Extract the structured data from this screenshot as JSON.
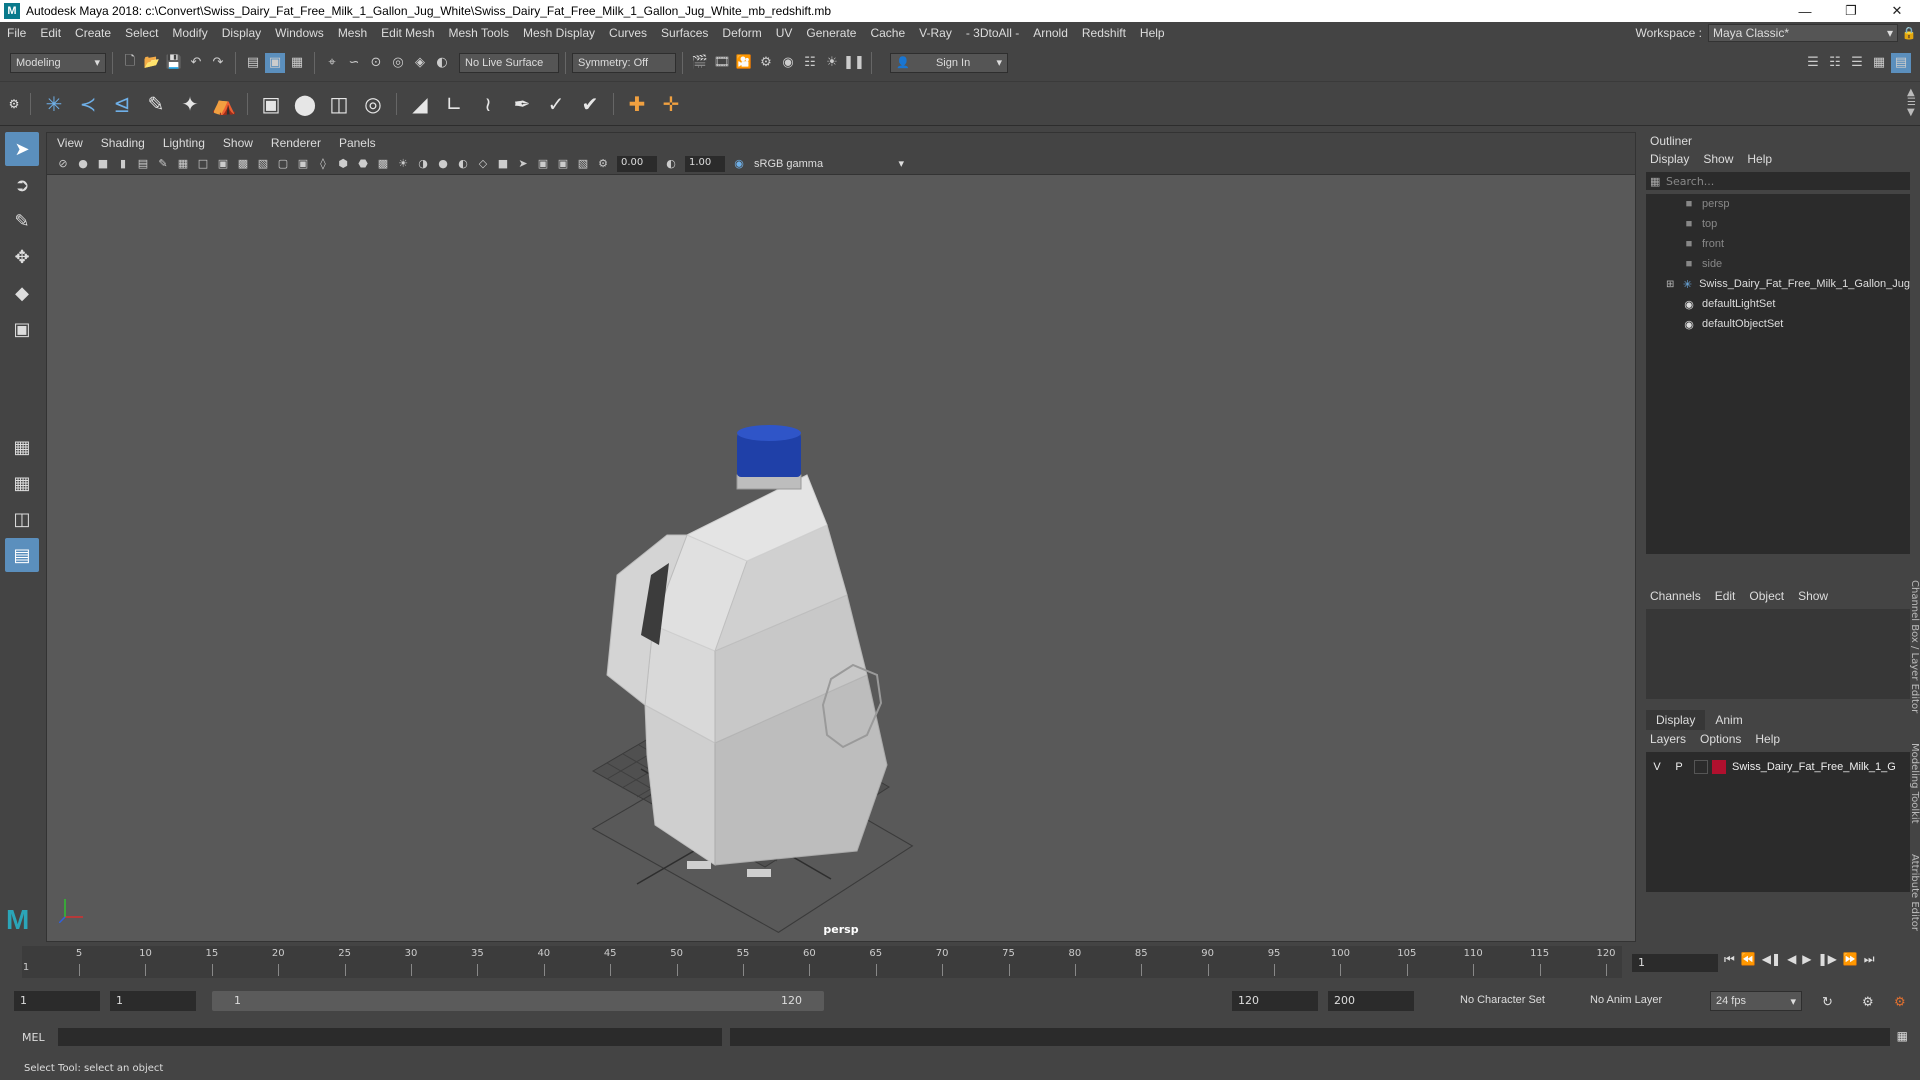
{
  "titlebar": {
    "title": "Autodesk Maya 2018: c:\\Convert\\Swiss_Dairy_Fat_Free_Milk_1_Gallon_Jug_White\\Swiss_Dairy_Fat_Free_Milk_1_Gallon_Jug_White_mb_redshift.mb",
    "icon": "M"
  },
  "menubar": {
    "items": [
      "File",
      "Edit",
      "Create",
      "Select",
      "Modify",
      "Display",
      "Windows",
      "Mesh",
      "Edit Mesh",
      "Mesh Tools",
      "Mesh Display",
      "Curves",
      "Surfaces",
      "Deform",
      "UV",
      "Generate",
      "Cache",
      "V-Ray",
      "- 3DtoAll -",
      "Arnold",
      "Redshift",
      "Help"
    ],
    "workspace_label": "Workspace :",
    "workspace_value": "Maya Classic*"
  },
  "statusline": {
    "mode": "Modeling",
    "live_surface": "No Live Surface",
    "symmetry": "Symmetry: Off",
    "sign_in": "Sign In"
  },
  "viewport": {
    "menus": [
      "View",
      "Shading",
      "Lighting",
      "Show",
      "Renderer",
      "Panels"
    ],
    "exposure": "0.00",
    "gamma": "1.00",
    "color_space": "sRGB gamma",
    "camera_label": "persp"
  },
  "outliner": {
    "title": "Outliner",
    "menus": [
      "Display",
      "Show",
      "Help"
    ],
    "search_placeholder": "Search...",
    "items": [
      {
        "label": "persp",
        "kind": "camera"
      },
      {
        "label": "top",
        "kind": "camera"
      },
      {
        "label": "front",
        "kind": "camera"
      },
      {
        "label": "side",
        "kind": "camera"
      },
      {
        "label": "Swiss_Dairy_Fat_Free_Milk_1_Gallon_Jug",
        "kind": "group"
      },
      {
        "label": "defaultLightSet",
        "kind": "set"
      },
      {
        "label": "defaultObjectSet",
        "kind": "set"
      }
    ]
  },
  "channelbox": {
    "menus": [
      "Channels",
      "Edit",
      "Object",
      "Show"
    ]
  },
  "layers": {
    "tabs": [
      "Display",
      "Anim"
    ],
    "menus": [
      "Layers",
      "Options",
      "Help"
    ],
    "row": {
      "v": "V",
      "p": "P",
      "name": "Swiss_Dairy_Fat_Free_Milk_1_G",
      "color": "#b0102e"
    }
  },
  "side_tabs": [
    "Channel Box / Layer Editor",
    "Modeling Toolkit",
    "Attribute Editor"
  ],
  "timeline": {
    "ticks": [
      "5",
      "10",
      "15",
      "20",
      "25",
      "30",
      "35",
      "40",
      "45",
      "50",
      "55",
      "60",
      "65",
      "70",
      "75",
      "80",
      "85",
      "90",
      "95",
      "100",
      "105",
      "110",
      "115",
      "120"
    ],
    "start_tick": "1",
    "current_frame": "1"
  },
  "range": {
    "start": "1",
    "playback_start": "1",
    "slider_start": "1",
    "slider_end": "120",
    "playback_end": "120",
    "end": "200",
    "character_set": "No Character Set",
    "anim_layer": "No Anim Layer",
    "fps": "24 fps"
  },
  "command": {
    "language": "MEL"
  },
  "helpline": {
    "text": "Select Tool: select an object"
  }
}
